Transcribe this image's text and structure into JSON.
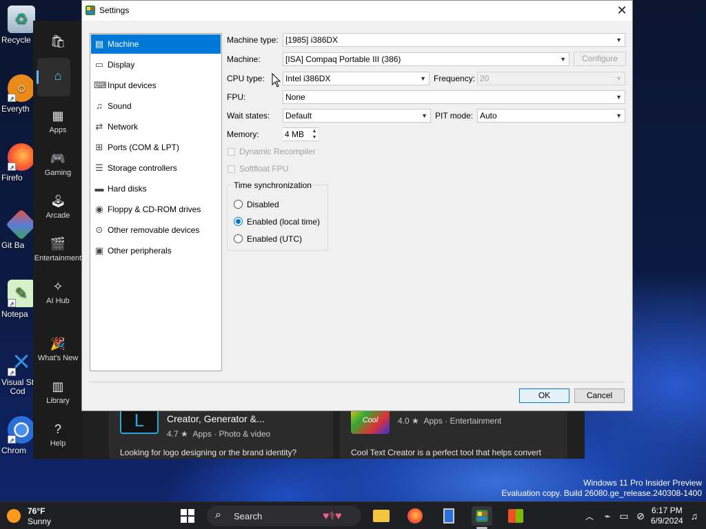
{
  "desktop": {
    "icons": [
      {
        "label": "Recycle",
        "icon": "recycle-bin-icon"
      },
      {
        "label": "Everyth",
        "icon": "search-tool-icon"
      },
      {
        "label": "Firefo",
        "icon": "firefox-icon"
      },
      {
        "label": "Git Ba",
        "icon": "git-icon"
      },
      {
        "label": "Notepa",
        "icon": "notepad-icon"
      },
      {
        "label": "Visual St\nCod",
        "icon": "vscode-icon"
      },
      {
        "label": "Chrom",
        "icon": "chrome-icon"
      }
    ],
    "watermark_line1": "Windows 11 Pro Insider Preview",
    "watermark_line2": "Evaluation copy. Build 26080.ge_release.240308-1400"
  },
  "store": {
    "rail": [
      {
        "label": "",
        "icon": "store-logo-icon"
      },
      {
        "label": "",
        "icon": "home-icon"
      },
      {
        "label": "Apps",
        "icon": "apps-icon"
      },
      {
        "label": "Gaming",
        "icon": "controller-icon"
      },
      {
        "label": "Arcade",
        "icon": "joystick-icon"
      },
      {
        "label": "Entertainment",
        "icon": "clapper-icon"
      },
      {
        "label": "AI Hub",
        "icon": "sparkle-icon"
      },
      {
        "label": "What's New",
        "icon": "party-icon"
      },
      {
        "label": "Library",
        "icon": "library-icon"
      },
      {
        "label": "Help",
        "icon": "help-icon"
      }
    ],
    "cards": [
      {
        "title": "Creator, Generator &...",
        "rating": "4.7 ★",
        "category1": "Apps",
        "category2": "Photo & video",
        "description": "Looking for logo designing or the brand identity?"
      },
      {
        "title": "",
        "rating": "4.0 ★",
        "category1": "Apps",
        "category2": "Entertainment",
        "description": "Cool Text Creator is a perfect tool that helps convert"
      }
    ]
  },
  "dialog": {
    "title": "Settings",
    "nav": [
      {
        "label": "Machine",
        "icon": "machine-icon",
        "selected": true
      },
      {
        "label": "Display",
        "icon": "display-icon"
      },
      {
        "label": "Input devices",
        "icon": "input-devices-icon"
      },
      {
        "label": "Sound",
        "icon": "sound-icon"
      },
      {
        "label": "Network",
        "icon": "network-icon"
      },
      {
        "label": "Ports (COM & LPT)",
        "icon": "ports-icon"
      },
      {
        "label": "Storage controllers",
        "icon": "storage-controller-icon"
      },
      {
        "label": "Hard disks",
        "icon": "hard-disk-icon"
      },
      {
        "label": "Floppy & CD-ROM drives",
        "icon": "floppy-icon"
      },
      {
        "label": "Other removable devices",
        "icon": "removable-device-icon"
      },
      {
        "label": "Other peripherals",
        "icon": "peripherals-icon"
      }
    ],
    "machine_type_label": "Machine type:",
    "machine_type_value": "[1985] i386DX",
    "machine_label": "Machine:",
    "machine_value": "[ISA] Compaq Portable III (386)",
    "configure_label": "Configure",
    "cpu_type_label": "CPU type:",
    "cpu_type_value": "Intel i386DX",
    "frequency_label": "Frequency:",
    "frequency_value": "20",
    "fpu_label": "FPU:",
    "fpu_value": "None",
    "wait_states_label": "Wait states:",
    "wait_states_value": "Default",
    "pit_mode_label": "PIT mode:",
    "pit_mode_value": "Auto",
    "memory_label": "Memory:",
    "memory_value": "4 MB",
    "dynamic_recompiler_label": "Dynamic Recompiler",
    "softfloat_label": "Softfloat FPU",
    "time_sync_title": "Time synchronization",
    "time_sync_options": [
      {
        "label": "Disabled",
        "checked": false
      },
      {
        "label": "Enabled (local time)",
        "checked": true
      },
      {
        "label": "Enabled (UTC)",
        "checked": false
      }
    ],
    "ok_label": "OK",
    "cancel_label": "Cancel"
  },
  "taskbar": {
    "weather_temp": "76°F",
    "weather_condition": "Sunny",
    "search_placeholder": "Search",
    "time": "6:17 PM",
    "date": "6/9/2024"
  },
  "colors": {
    "accent": "#0078d7",
    "dialog_bg": "#f0f0f0",
    "taskbar_bg": "#1f2024",
    "store_bg": "#202020"
  }
}
